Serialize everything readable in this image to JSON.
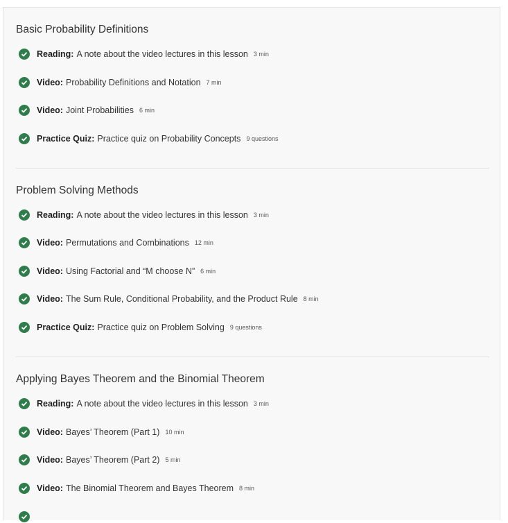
{
  "sections": [
    {
      "title": "Basic Probability Definitions",
      "items": [
        {
          "kind": "Reading:",
          "title": "A note about the video lectures in this lesson",
          "meta": "3 min"
        },
        {
          "kind": "Video:",
          "title": "Probability Definitions and Notation",
          "meta": "7 min"
        },
        {
          "kind": "Video:",
          "title": "Joint Probabilities",
          "meta": "6 min"
        },
        {
          "kind": "Practice Quiz:",
          "title": "Practice quiz on Probability Concepts",
          "meta": "9 questions"
        }
      ]
    },
    {
      "title": "Problem Solving Methods",
      "items": [
        {
          "kind": "Reading:",
          "title": "A note about the video lectures in this lesson",
          "meta": "3 min"
        },
        {
          "kind": "Video:",
          "title": "Permutations and Combinations",
          "meta": "12 min"
        },
        {
          "kind": "Video:",
          "title": "Using Factorial and “M choose N”",
          "meta": "6 min"
        },
        {
          "kind": "Video:",
          "title": "The Sum Rule, Conditional Probability, and the Product Rule",
          "meta": "8 min"
        },
        {
          "kind": "Practice Quiz:",
          "title": "Practice quiz on Problem Solving",
          "meta": "9 questions"
        }
      ]
    },
    {
      "title": "Applying Bayes Theorem and the Binomial Theorem",
      "items": [
        {
          "kind": "Reading:",
          "title": "A note about the video lectures in this lesson",
          "meta": "3 min"
        },
        {
          "kind": "Video:",
          "title": "Bayes’ Theorem (Part 1)",
          "meta": "10 min"
        },
        {
          "kind": "Video:",
          "title": "Bayes’ Theorem (Part 2)",
          "meta": "5 min"
        },
        {
          "kind": "Video:",
          "title": "The Binomial Theorem and Bayes Theorem",
          "meta": "8 min"
        }
      ]
    }
  ],
  "colors": {
    "check": "#2e7d4a",
    "panel_bg": "#f8f8f8",
    "divider": "#e2e2e2"
  },
  "icons": {
    "completed": "checkmark-circle-icon"
  }
}
